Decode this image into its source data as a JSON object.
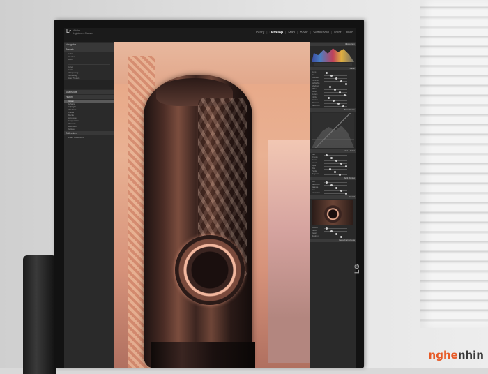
{
  "app": {
    "logo": "Lr",
    "name_line1": "Adobe",
    "name_line2": "Lightroom Classic",
    "modules": [
      "Library",
      "Develop",
      "Map",
      "Book",
      "Slideshow",
      "Print",
      "Web"
    ],
    "active_module": "Develop"
  },
  "left_panel": {
    "navigator": "Navigator",
    "presets": "Presets",
    "preset_items": [
      "Color",
      "Creative",
      "B&W"
    ],
    "history_items": [
      "Curve",
      "Grain",
      "Sharpening",
      "Vignetting"
    ],
    "user_presets": "User Presets",
    "snapshots": "Snapshots",
    "history": "History",
    "history_list": [
      "Import",
      "Dehaze",
      "Highlight",
      "Shadows",
      "Whites",
      "Blacks",
      "Exposure",
      "Temperature",
      "Vibrance",
      "Saturation",
      "Texture"
    ],
    "collections": "Collections",
    "smart_collections": "Smart Collections"
  },
  "right_panel": {
    "histogram": "Histogram",
    "basic": "Basic",
    "basic_sliders": [
      "Temp",
      "Tint",
      "Exposure",
      "Contrast",
      "Highlights",
      "Shadows",
      "Whites",
      "Blacks",
      "Texture",
      "Clarity",
      "Dehaze",
      "Vibrance",
      "Saturation"
    ],
    "tone_curve": "Tone Curve",
    "hsl": "HSL / Color",
    "hsl_sliders": [
      "Red",
      "Orange",
      "Yellow",
      "Green",
      "Aqua",
      "Blue",
      "Purple",
      "Magenta"
    ],
    "split_toning": "Split Toning",
    "split_sliders": [
      "Hue",
      "Saturation",
      "Balance",
      "Hue",
      "Saturation"
    ],
    "detail": "Detail",
    "detail_sliders": [
      "Amount",
      "Radius",
      "Detail",
      "Masking"
    ],
    "lens_corrections": "Lens Corrections"
  },
  "brand": {
    "monitor_logo": "LG",
    "watermark_part1": "nghe",
    "watermark_part2": "nhin"
  }
}
